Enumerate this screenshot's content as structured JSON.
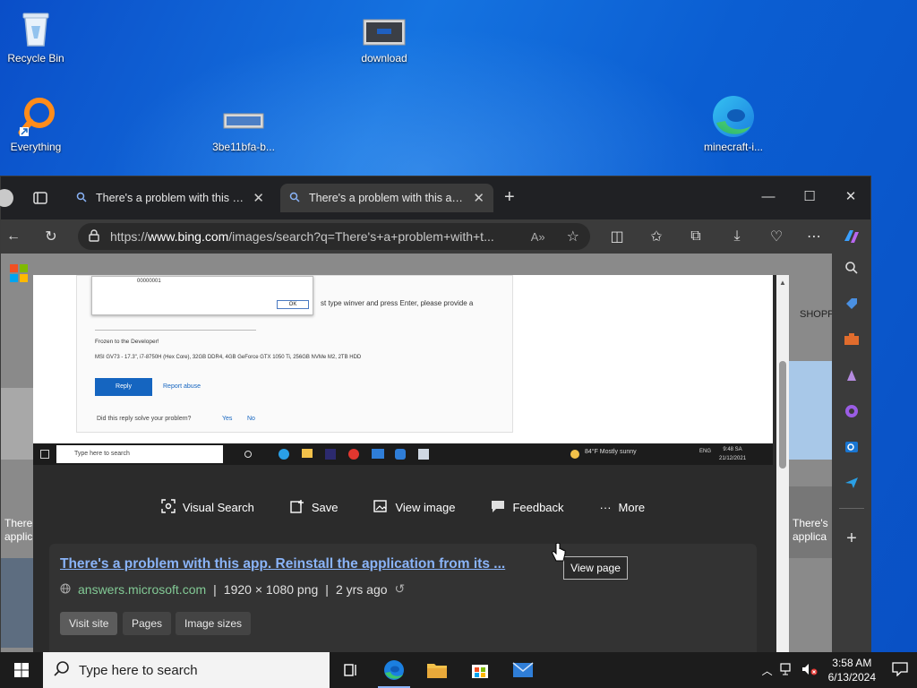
{
  "desktop": {
    "icons": [
      {
        "label": "Recycle Bin"
      },
      {
        "label": "download"
      },
      {
        "label": "Everything"
      },
      {
        "label": "3be11bfa-b..."
      },
      {
        "label": "minecraft-i..."
      }
    ]
  },
  "browser": {
    "tabs": [
      {
        "title": "There's a problem with this app."
      },
      {
        "title": "There's a problem with this app."
      }
    ],
    "address": {
      "prefix": "https://",
      "host": "www.bing.com",
      "path": "/images/search?q=There's+a+problem+with+t..."
    },
    "page": {
      "left_logo": "microsoft-logo",
      "shop_label": "SHOPP",
      "side_snippet": "There's applica",
      "left_snippet": "There applic",
      "preview": {
        "dialog_code": "00000001",
        "dialog_button": "OK",
        "line1": "st type winver and press Enter, please provide a",
        "posted_by": "Frozen to the Developer!",
        "specs": "MSI GV73 - 17.3\", i7-8750H (Hex Core), 32GB DDR4, 4GB GeForce GTX 1050 Ti, 256GB NVMe M2, 2TB HDD",
        "reply_label": "Reply",
        "report_label": "Report abuse",
        "solve_question": "Did this reply solve your problem?",
        "yes": "Yes",
        "no": "No",
        "mini_taskbar": {
          "search": "Type here to search",
          "weather": "84°F  Mostly sunny",
          "lang": "ENG",
          "time": "9:48 SA",
          "date": "21/12/2021"
        }
      },
      "actions": [
        {
          "label": "Visual Search"
        },
        {
          "label": "Save"
        },
        {
          "label": "View image"
        },
        {
          "label": "Feedback"
        },
        {
          "label": "More"
        }
      ],
      "result": {
        "title": "There's a problem with this app. Reinstall the application from its ...",
        "domain": "answers.microsoft.com",
        "dimensions": "1920 × 1080 png",
        "age": "2 yrs ago",
        "buttons": [
          "Visit site",
          "Pages",
          "Image sizes"
        ]
      },
      "tooltip": "View page"
    }
  },
  "taskbar": {
    "search_placeholder": "Type here to search",
    "time": "3:58 AM",
    "date": "6/13/2024"
  }
}
